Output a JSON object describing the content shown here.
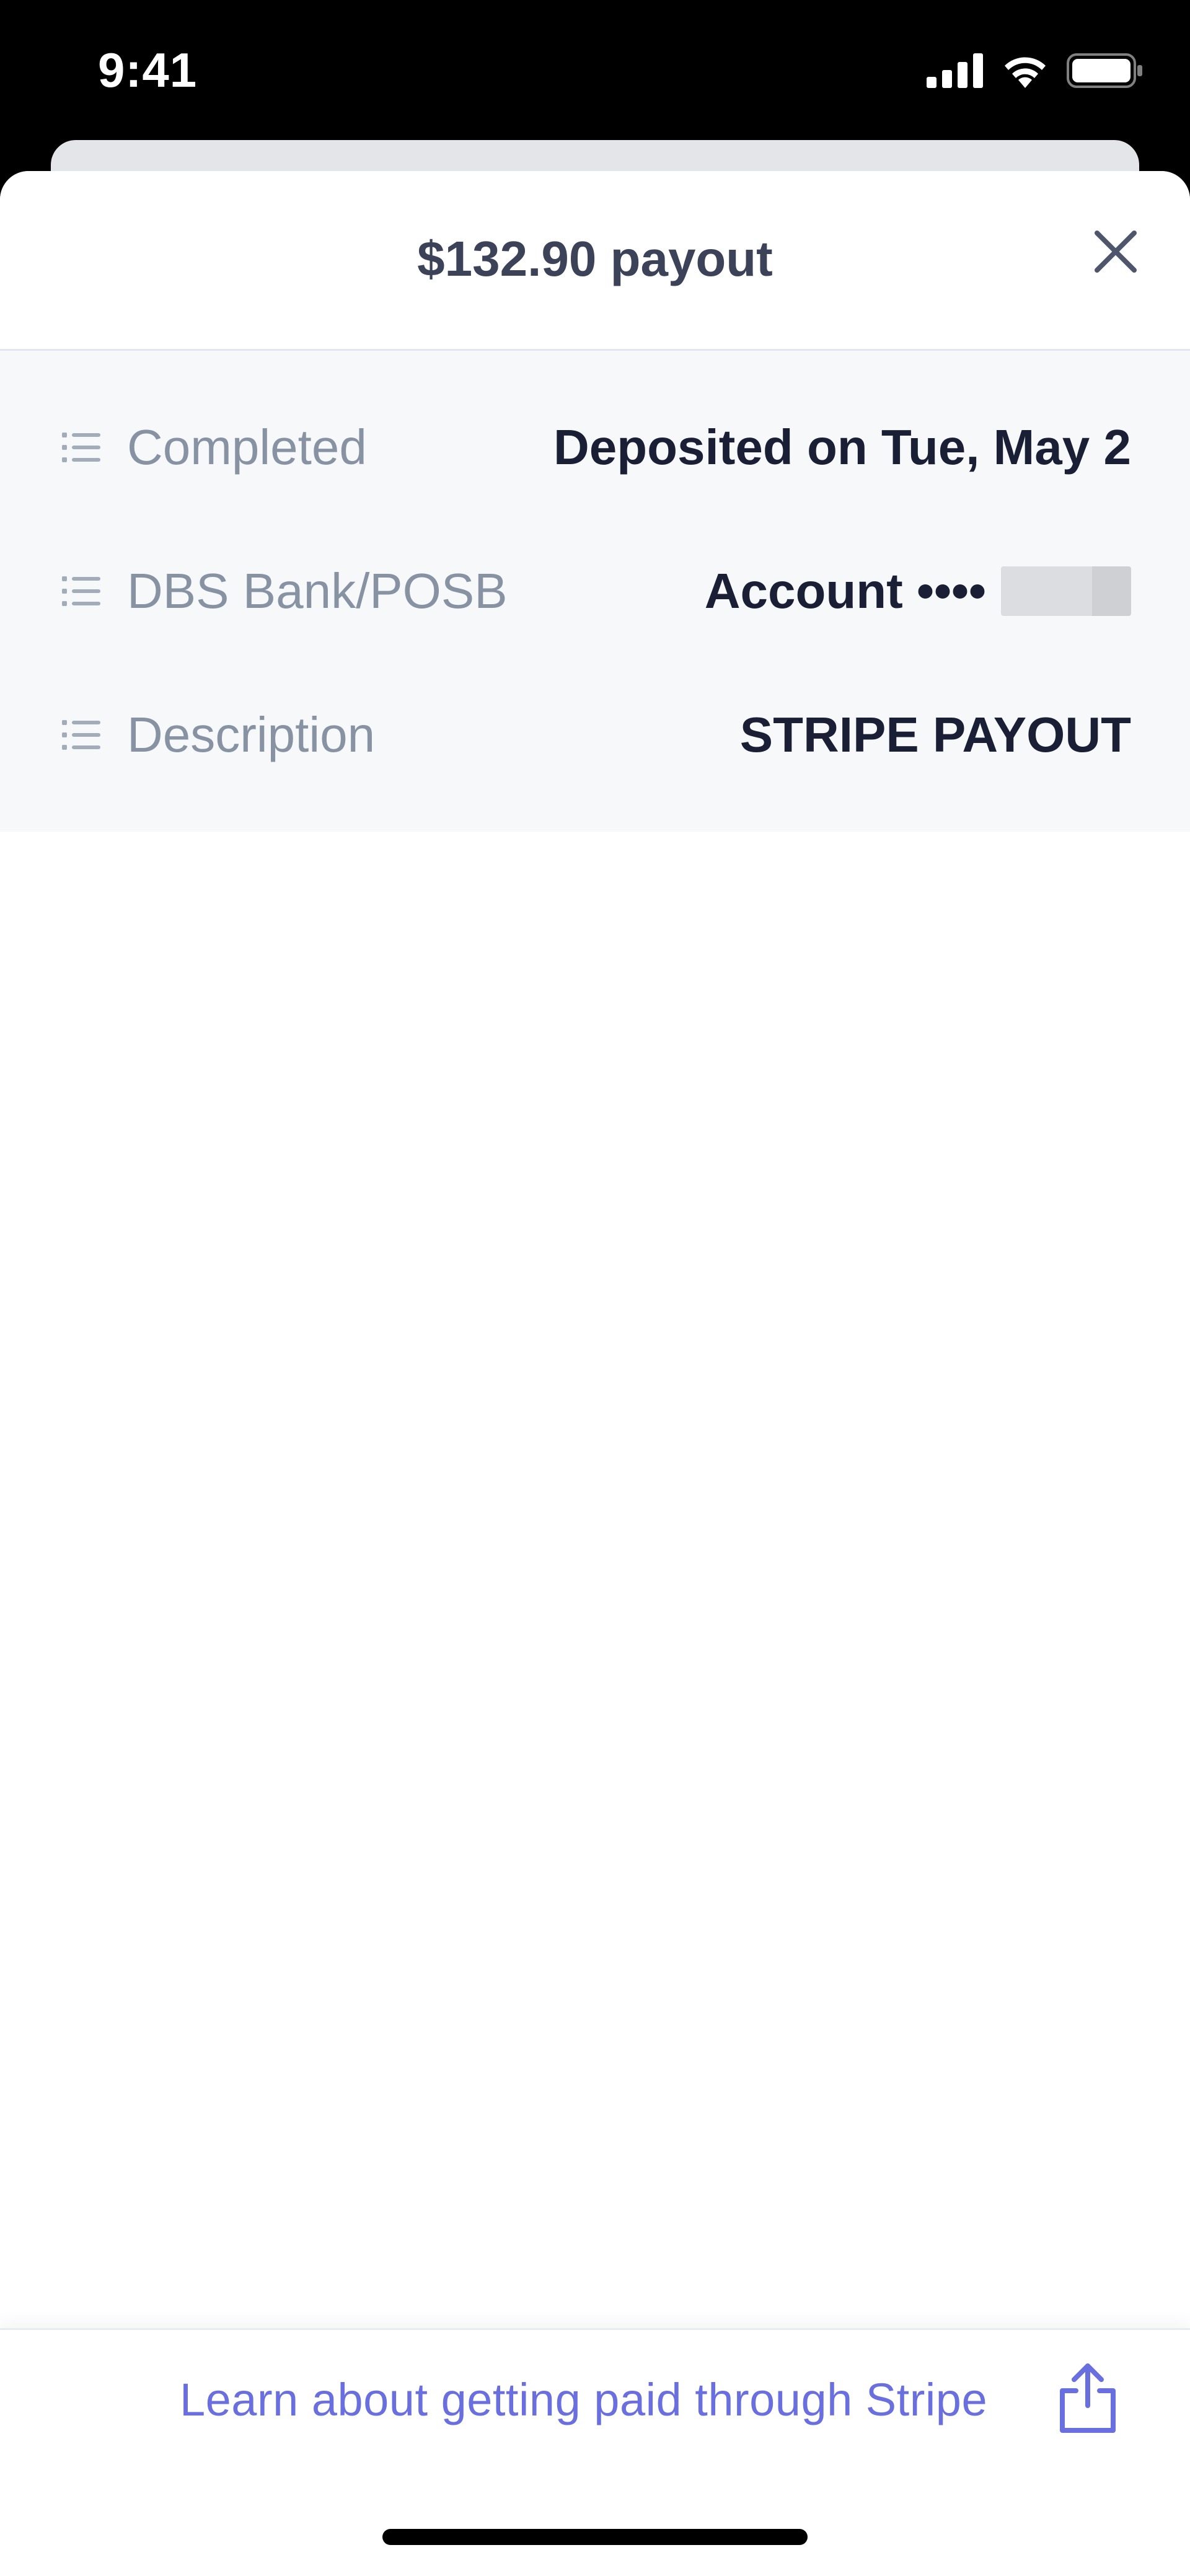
{
  "status_bar": {
    "time": "9:41",
    "icons": [
      "cellular-signal-icon",
      "wifi-icon",
      "battery-icon"
    ]
  },
  "sheet": {
    "title": "$132.90 payout",
    "close_icon": "close-icon"
  },
  "details": [
    {
      "icon": "list-icon",
      "label": "Completed",
      "value": "Deposited on Tue, May 2"
    },
    {
      "icon": "list-icon",
      "label": "DBS Bank/POSB",
      "value": "Account ••••"
    },
    {
      "icon": "list-icon",
      "label": "Description",
      "value": "STRIPE PAYOUT"
    }
  ],
  "footer": {
    "link_text": "Learn about getting paid through Stripe",
    "share_icon": "share-icon"
  },
  "colors": {
    "accent": "#6a6fe0",
    "title": "#3c4257",
    "label": "#8792a2",
    "value": "#1a1f36",
    "details_bg": "#f6f8fa"
  }
}
